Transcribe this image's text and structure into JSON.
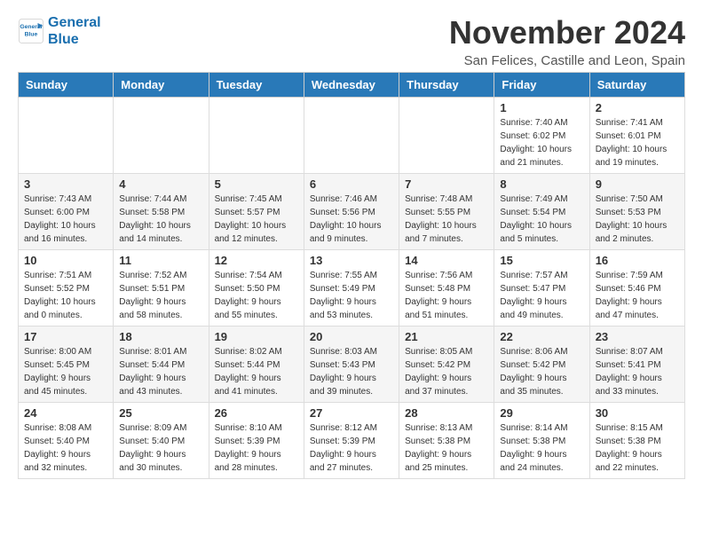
{
  "header": {
    "logo_line1": "General",
    "logo_line2": "Blue",
    "month_title": "November 2024",
    "location": "San Felices, Castille and Leon, Spain"
  },
  "days_of_week": [
    "Sunday",
    "Monday",
    "Tuesday",
    "Wednesday",
    "Thursday",
    "Friday",
    "Saturday"
  ],
  "weeks": [
    [
      {
        "day": "",
        "info": ""
      },
      {
        "day": "",
        "info": ""
      },
      {
        "day": "",
        "info": ""
      },
      {
        "day": "",
        "info": ""
      },
      {
        "day": "",
        "info": ""
      },
      {
        "day": "1",
        "info": "Sunrise: 7:40 AM\nSunset: 6:02 PM\nDaylight: 10 hours and 21 minutes."
      },
      {
        "day": "2",
        "info": "Sunrise: 7:41 AM\nSunset: 6:01 PM\nDaylight: 10 hours and 19 minutes."
      }
    ],
    [
      {
        "day": "3",
        "info": "Sunrise: 7:43 AM\nSunset: 6:00 PM\nDaylight: 10 hours and 16 minutes."
      },
      {
        "day": "4",
        "info": "Sunrise: 7:44 AM\nSunset: 5:58 PM\nDaylight: 10 hours and 14 minutes."
      },
      {
        "day": "5",
        "info": "Sunrise: 7:45 AM\nSunset: 5:57 PM\nDaylight: 10 hours and 12 minutes."
      },
      {
        "day": "6",
        "info": "Sunrise: 7:46 AM\nSunset: 5:56 PM\nDaylight: 10 hours and 9 minutes."
      },
      {
        "day": "7",
        "info": "Sunrise: 7:48 AM\nSunset: 5:55 PM\nDaylight: 10 hours and 7 minutes."
      },
      {
        "day": "8",
        "info": "Sunrise: 7:49 AM\nSunset: 5:54 PM\nDaylight: 10 hours and 5 minutes."
      },
      {
        "day": "9",
        "info": "Sunrise: 7:50 AM\nSunset: 5:53 PM\nDaylight: 10 hours and 2 minutes."
      }
    ],
    [
      {
        "day": "10",
        "info": "Sunrise: 7:51 AM\nSunset: 5:52 PM\nDaylight: 10 hours and 0 minutes."
      },
      {
        "day": "11",
        "info": "Sunrise: 7:52 AM\nSunset: 5:51 PM\nDaylight: 9 hours and 58 minutes."
      },
      {
        "day": "12",
        "info": "Sunrise: 7:54 AM\nSunset: 5:50 PM\nDaylight: 9 hours and 55 minutes."
      },
      {
        "day": "13",
        "info": "Sunrise: 7:55 AM\nSunset: 5:49 PM\nDaylight: 9 hours and 53 minutes."
      },
      {
        "day": "14",
        "info": "Sunrise: 7:56 AM\nSunset: 5:48 PM\nDaylight: 9 hours and 51 minutes."
      },
      {
        "day": "15",
        "info": "Sunrise: 7:57 AM\nSunset: 5:47 PM\nDaylight: 9 hours and 49 minutes."
      },
      {
        "day": "16",
        "info": "Sunrise: 7:59 AM\nSunset: 5:46 PM\nDaylight: 9 hours and 47 minutes."
      }
    ],
    [
      {
        "day": "17",
        "info": "Sunrise: 8:00 AM\nSunset: 5:45 PM\nDaylight: 9 hours and 45 minutes."
      },
      {
        "day": "18",
        "info": "Sunrise: 8:01 AM\nSunset: 5:44 PM\nDaylight: 9 hours and 43 minutes."
      },
      {
        "day": "19",
        "info": "Sunrise: 8:02 AM\nSunset: 5:44 PM\nDaylight: 9 hours and 41 minutes."
      },
      {
        "day": "20",
        "info": "Sunrise: 8:03 AM\nSunset: 5:43 PM\nDaylight: 9 hours and 39 minutes."
      },
      {
        "day": "21",
        "info": "Sunrise: 8:05 AM\nSunset: 5:42 PM\nDaylight: 9 hours and 37 minutes."
      },
      {
        "day": "22",
        "info": "Sunrise: 8:06 AM\nSunset: 5:42 PM\nDaylight: 9 hours and 35 minutes."
      },
      {
        "day": "23",
        "info": "Sunrise: 8:07 AM\nSunset: 5:41 PM\nDaylight: 9 hours and 33 minutes."
      }
    ],
    [
      {
        "day": "24",
        "info": "Sunrise: 8:08 AM\nSunset: 5:40 PM\nDaylight: 9 hours and 32 minutes."
      },
      {
        "day": "25",
        "info": "Sunrise: 8:09 AM\nSunset: 5:40 PM\nDaylight: 9 hours and 30 minutes."
      },
      {
        "day": "26",
        "info": "Sunrise: 8:10 AM\nSunset: 5:39 PM\nDaylight: 9 hours and 28 minutes."
      },
      {
        "day": "27",
        "info": "Sunrise: 8:12 AM\nSunset: 5:39 PM\nDaylight: 9 hours and 27 minutes."
      },
      {
        "day": "28",
        "info": "Sunrise: 8:13 AM\nSunset: 5:38 PM\nDaylight: 9 hours and 25 minutes."
      },
      {
        "day": "29",
        "info": "Sunrise: 8:14 AM\nSunset: 5:38 PM\nDaylight: 9 hours and 24 minutes."
      },
      {
        "day": "30",
        "info": "Sunrise: 8:15 AM\nSunset: 5:38 PM\nDaylight: 9 hours and 22 minutes."
      }
    ]
  ]
}
